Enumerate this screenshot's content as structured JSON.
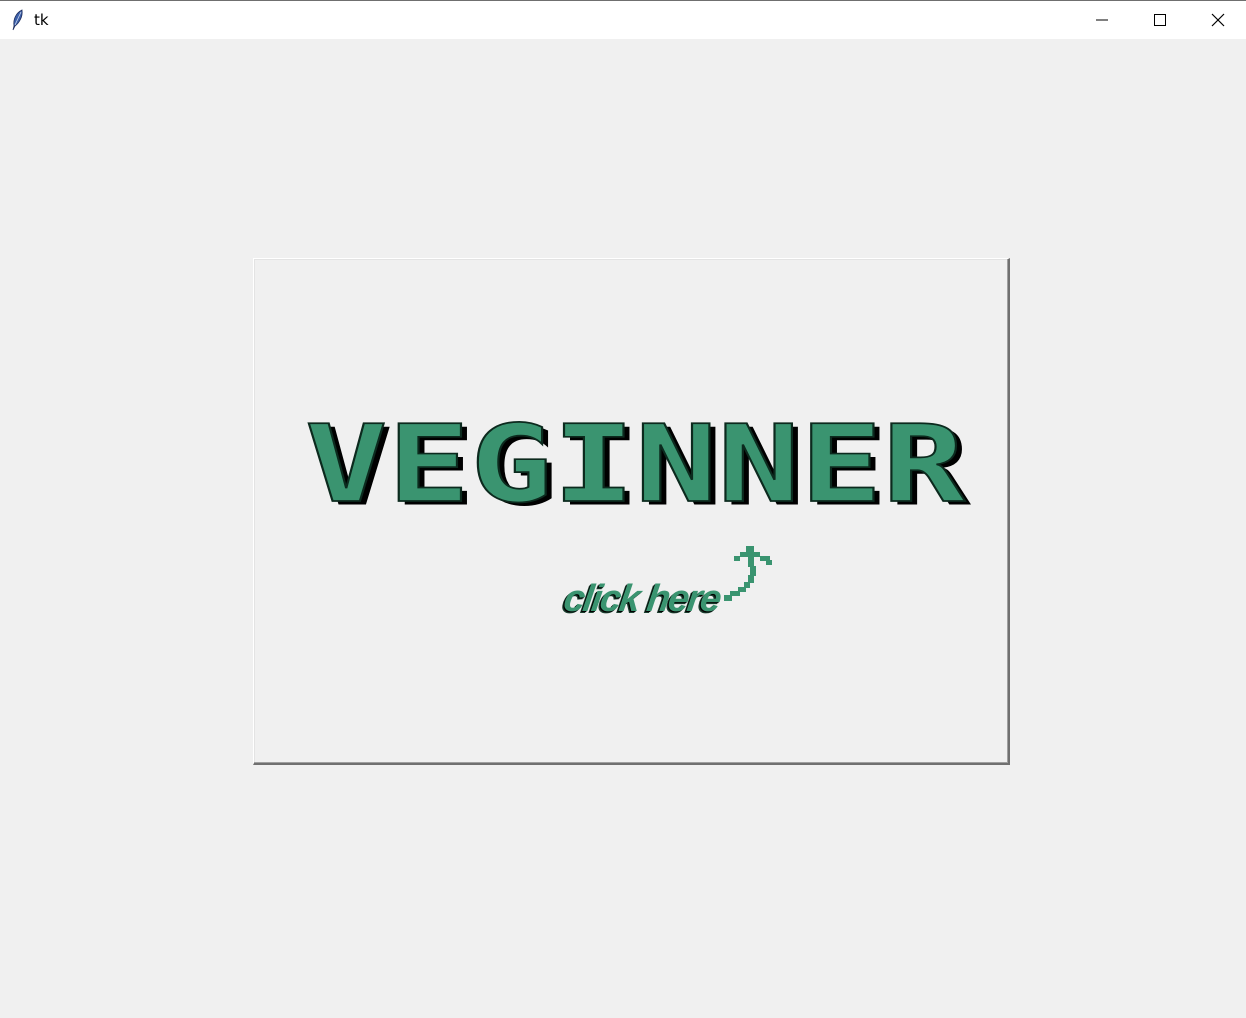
{
  "window": {
    "title": "tk",
    "controls": {
      "minimize": "minimize-icon",
      "maximize": "maximize-icon",
      "close": "close-icon"
    }
  },
  "button_image": {
    "logo_text": "VEGINNER",
    "hint_text": "click here",
    "colors": {
      "accent": "#3a9470",
      "shadow": "#000000",
      "background": "#f0f0f0"
    },
    "hint_icon": "curved-arrow-up-icon"
  }
}
